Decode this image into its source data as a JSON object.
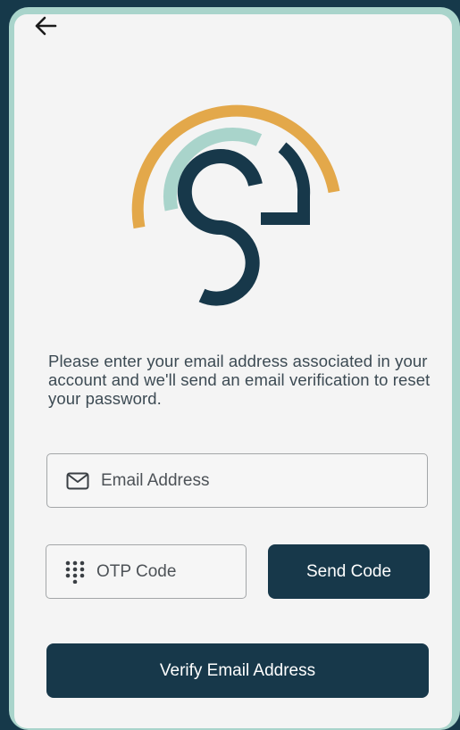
{
  "screen": {
    "back_icon": "arrow-left-icon",
    "logo_icon": "brand-logo-s",
    "colors": {
      "background": "#16394a",
      "frame": "#a9d4cb",
      "card": "#f4f4f4",
      "primary": "#17384a",
      "logo_gold": "#e3a84a",
      "logo_teal": "#a9d4cb",
      "logo_navy": "#17384a"
    }
  },
  "intro": {
    "text": "Please enter your email address associated in your account and we'll send an email verification to reset your password."
  },
  "form": {
    "email": {
      "icon": "envelope-icon",
      "placeholder": "Email Address",
      "value": ""
    },
    "otp": {
      "icon": "keypad-icon",
      "placeholder": "OTP Code",
      "value": ""
    },
    "send_code_label": "Send Code",
    "verify_label": "Verify Email Address"
  }
}
